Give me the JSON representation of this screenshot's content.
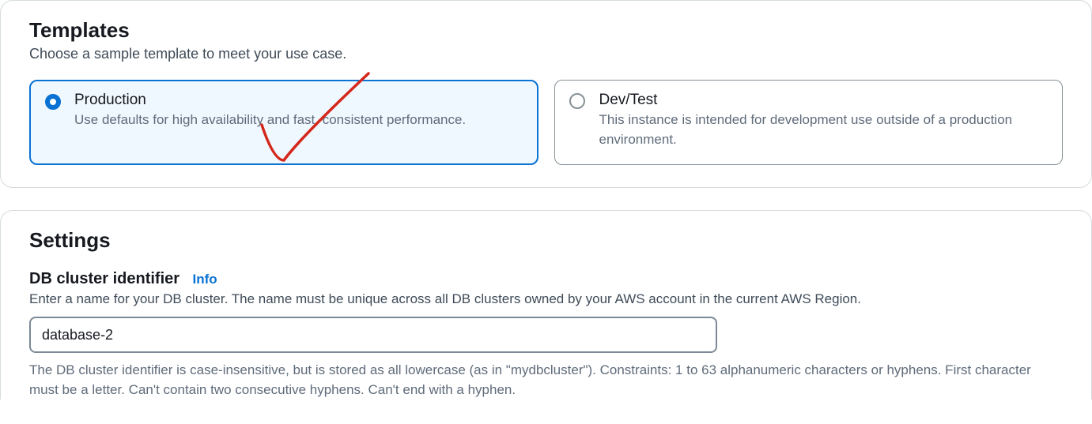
{
  "templates": {
    "title": "Templates",
    "subtitle": "Choose a sample template to meet your use case.",
    "options": [
      {
        "label": "Production",
        "description": "Use defaults for high availability and fast, consistent performance."
      },
      {
        "label": "Dev/Test",
        "description": "This instance is intended for development use outside of a production environment."
      }
    ]
  },
  "settings": {
    "title": "Settings",
    "cluster_id": {
      "label": "DB cluster identifier",
      "info_label": "Info",
      "help": "Enter a name for your DB cluster. The name must be unique across all DB clusters owned by your AWS account in the current AWS Region.",
      "value": "database-2",
      "constraints": "The DB cluster identifier is case-insensitive, but is stored as all lowercase (as in \"mydbcluster\"). Constraints: 1 to 63 alphanumeric characters or hyphens. First character must be a letter. Can't contain two consecutive hyphens. Can't end with a hyphen."
    }
  }
}
